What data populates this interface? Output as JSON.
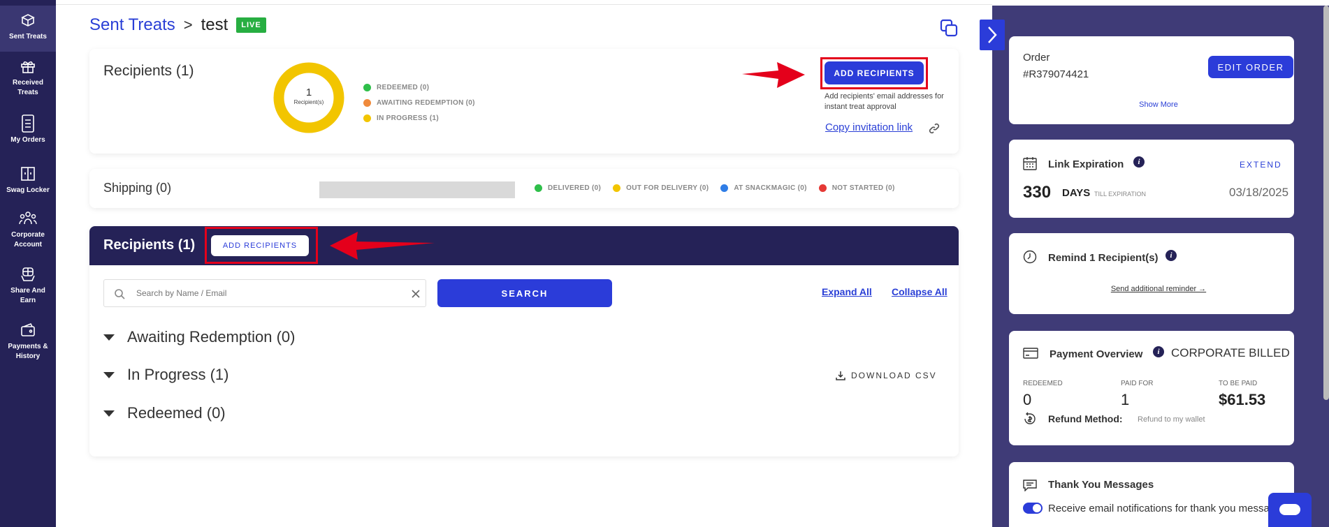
{
  "nav": {
    "items": [
      {
        "label": "Sent Treats",
        "icon": "gift-box-icon"
      },
      {
        "label": "Received Treats",
        "icon": "gift-icon"
      },
      {
        "label": "My Orders",
        "icon": "orders-icon"
      },
      {
        "label": "Swag Locker",
        "icon": "locker-icon"
      },
      {
        "label": "Corporate Account",
        "icon": "people-icon"
      },
      {
        "label": "Share And Earn",
        "icon": "share-gift-icon"
      },
      {
        "label": "Payments & History",
        "icon": "wallet-icon"
      }
    ]
  },
  "header": {
    "breadcrumb_link": "Sent Treats",
    "separator": ">",
    "current": "test",
    "badge": "LIVE"
  },
  "recipients_summary": {
    "title": "Recipients (1)",
    "donut_count": "1",
    "donut_label": "Recipient(s)",
    "legend": [
      {
        "label": "REDEEMED (0)",
        "color": "#2fbf4a"
      },
      {
        "label": "AWAITING REDEMPTION (0)",
        "color": "#f08a3c"
      },
      {
        "label": "IN PROGRESS (1)",
        "color": "#f2c500"
      }
    ],
    "add_button": "ADD RECIPIENTS",
    "help_text": "Add recipients' email addresses for instant treat approval",
    "invite_link": "Copy invitation link"
  },
  "shipping": {
    "title": "Shipping (0)",
    "legend": [
      {
        "label": "DELIVERED (0)",
        "color": "#2fbf4a"
      },
      {
        "label": "OUT FOR DELIVERY (0)",
        "color": "#f2c500"
      },
      {
        "label": "AT SNACKMAGIC (0)",
        "color": "#2f7de6"
      },
      {
        "label": "NOT STARTED (0)",
        "color": "#e53935"
      }
    ]
  },
  "recipients_list": {
    "title": "Recipients (1)",
    "add_button": "ADD RECIPIENTS",
    "search_placeholder": "Search by Name / Email",
    "search_button": "SEARCH",
    "expand_all": "Expand All",
    "collapse_all": "Collapse All",
    "groups": [
      {
        "label": "Awaiting Redemption (0)"
      },
      {
        "label": "In Progress (1)"
      },
      {
        "label": "Redeemed (0)"
      }
    ],
    "download_csv": "DOWNLOAD CSV"
  },
  "sidebar": {
    "order": {
      "label": "Order",
      "number": "#R379074421",
      "edit_button": "EDIT ORDER",
      "show_more": "Show More"
    },
    "link_expiration": {
      "title": "Link Expiration",
      "extend": "EXTEND",
      "days": "330",
      "days_unit": "DAYS",
      "till": "TILL EXPIRATION",
      "date": "03/18/2025"
    },
    "remind": {
      "title": "Remind 1 Recipient(s)",
      "link": "Send additional reminder →"
    },
    "payment": {
      "title": "Payment Overview",
      "billing": "CORPORATE BILLED",
      "redeemed_label": "REDEEMED",
      "redeemed_value": "0",
      "paid_label": "PAID FOR",
      "paid_value": "1",
      "to_pay_label": "TO BE PAID",
      "to_pay_value": "$61.53",
      "refund_label": "Refund Method:",
      "refund_value": "Refund to my wallet"
    },
    "thanks": {
      "title": "Thank You Messages",
      "notif_text": "Receive email notifications for thank you messa",
      "notif_enabled": true
    }
  },
  "colors": {
    "accent": "#2b3cd9",
    "nav_bg": "#252257",
    "sidebar_bg": "#3f3b77",
    "highlight": "#e4001b"
  }
}
